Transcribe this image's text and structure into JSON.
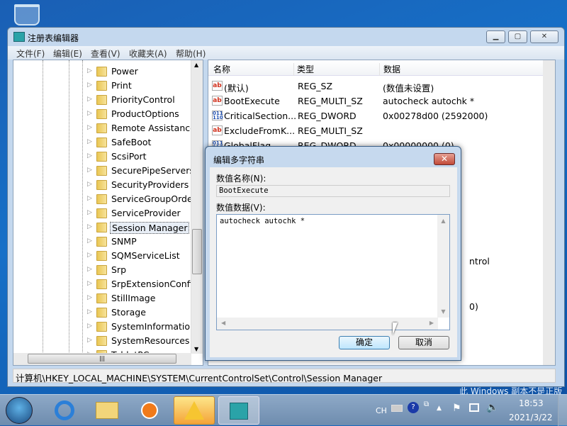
{
  "desktop": {
    "watermark": "此 Windows 副本不是正版"
  },
  "window": {
    "title": "注册表编辑器",
    "controls": [
      "▁",
      "▢",
      "✕"
    ]
  },
  "menu": [
    "文件(F)",
    "编辑(E)",
    "查看(V)",
    "收藏夹(A)",
    "帮助(H)"
  ],
  "tree": {
    "items": [
      "Power",
      "Print",
      "PriorityControl",
      "ProductOptions",
      "Remote Assistance",
      "SafeBoot",
      "ScsiPort",
      "SecurePipeServers",
      "SecurityProviders",
      "ServiceGroupOrder",
      "ServiceProvider",
      "Session Manager",
      "SNMP",
      "SQMServiceList",
      "Srp",
      "SrpExtensionConfig",
      "StillImage",
      "Storage",
      "SystemInformation",
      "SystemResources",
      "TabletPC"
    ],
    "selected": "Session Manager"
  },
  "list": {
    "columns": [
      "名称",
      "类型",
      "数据"
    ],
    "rows": [
      {
        "icon": "string-value-icon",
        "name": "(默认)",
        "type": "REG_SZ",
        "data": "(数值未设置)"
      },
      {
        "icon": "string-value-icon",
        "name": "BootExecute",
        "type": "REG_MULTI_SZ",
        "data": "autocheck autochk *"
      },
      {
        "icon": "binary-value-icon",
        "name": "CriticalSection...",
        "type": "REG_DWORD",
        "data": "0x00278d00 (2592000)"
      },
      {
        "icon": "string-value-icon",
        "name": "ExcludeFromK...",
        "type": "REG_MULTI_SZ",
        "data": ""
      },
      {
        "icon": "binary-value-icon",
        "name": "GlobalFlag",
        "type": "REG_DWORD",
        "data": "0x00000000 (0)"
      }
    ],
    "fragments": [
      "ntrol",
      "0)"
    ]
  },
  "status": "计算机\\HKEY_LOCAL_MACHINE\\SYSTEM\\CurrentControlSet\\Control\\Session Manager",
  "dialog": {
    "title": "编辑多字符串",
    "name_label": "数值名称(N):",
    "name_value": "BootExecute",
    "data_label": "数值数据(V):",
    "data_value": "autocheck autochk *",
    "ok": "确定",
    "cancel": "取消",
    "close": "✕"
  },
  "taskbar": {
    "lang": "CH",
    "time": "18:53",
    "date": "2021/3/22"
  }
}
